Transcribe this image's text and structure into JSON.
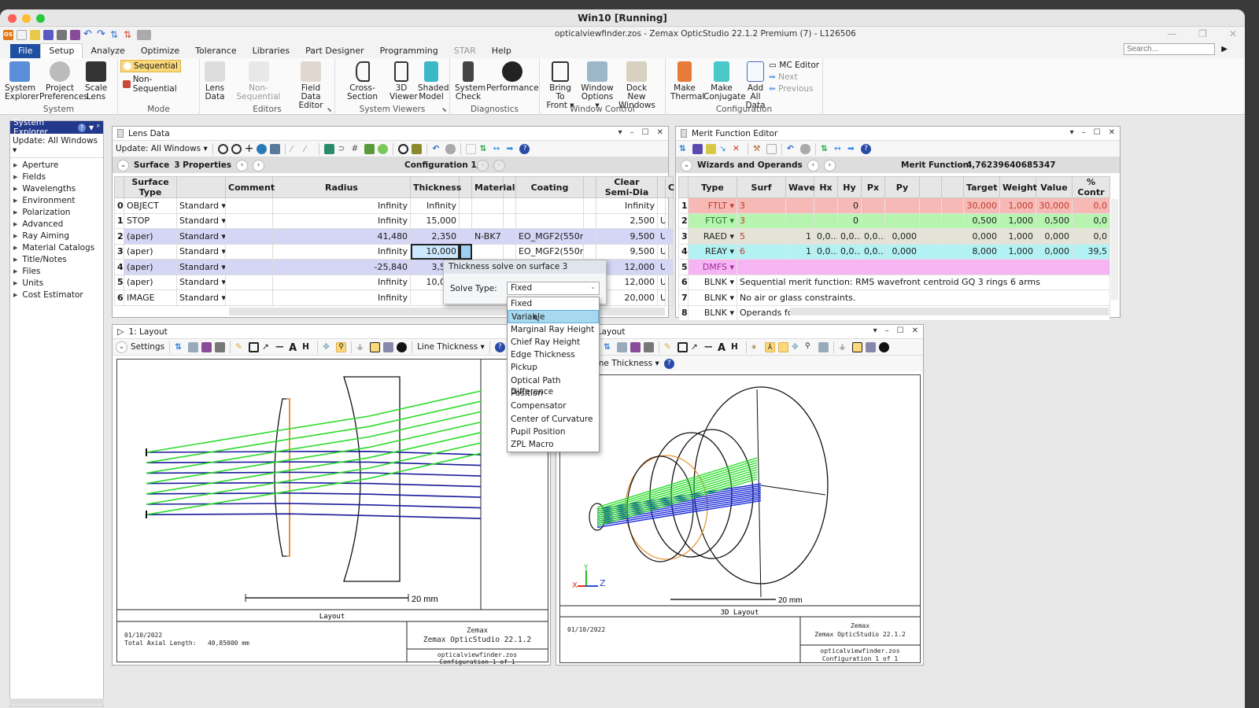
{
  "vm": {
    "title": "Win10 [Running]"
  },
  "app": {
    "title": "opticalviewfinder.zos - Zemax OpticStudio 22.1.2   Premium (7) - L126506",
    "logo": "OS"
  },
  "menu": {
    "tabs": [
      "File",
      "Setup",
      "Analyze",
      "Optimize",
      "Tolerance",
      "Libraries",
      "Part Designer",
      "Programming",
      "STAR",
      "Help"
    ],
    "active": "Setup",
    "search_placeholder": "Search..."
  },
  "ribbon": {
    "system": {
      "label": "System",
      "buttons": [
        "System Explorer",
        "Project Preferences",
        "Scale Lens"
      ]
    },
    "mode": {
      "label": "Mode",
      "sequential": "Sequential",
      "non_sequential": "Non-Sequential"
    },
    "editors": {
      "label": "Editors",
      "buttons": [
        "Lens Data",
        "Non-Sequential",
        "Field Data Editor"
      ]
    },
    "viewers": {
      "label": "System Viewers",
      "buttons": [
        "Cross-Section",
        "3D Viewer",
        "Shaded Model"
      ]
    },
    "diagnostics": {
      "label": "Diagnostics",
      "buttons": [
        "System Check",
        "Performance"
      ]
    },
    "window": {
      "label": "Window Control",
      "buttons": [
        "Bring To Front ▾",
        "Window Options ▾",
        "Dock New Windows"
      ]
    },
    "config": {
      "label": "Configuration",
      "buttons": [
        "Make Thermal",
        "Make Conjugate",
        "Add All Data"
      ],
      "small": [
        "MC Editor",
        "Next",
        "Previous"
      ]
    }
  },
  "explorer": {
    "title": "System Explorer",
    "update": "Update: All Windows ▾",
    "items": [
      "Aperture",
      "Fields",
      "Wavelengths",
      "Environment",
      "Polarization",
      "Advanced",
      "Ray Aiming",
      "Material Catalogs",
      "Title/Notes",
      "Files",
      "Units",
      "Cost Estimator"
    ]
  },
  "lens": {
    "title": "Lens Data",
    "update": "Update: All Windows ▾",
    "surface_label": "Surface",
    "properties": "3 Properties",
    "config": "Configuration 1/1",
    "columns": [
      "",
      "Surface Type",
      "",
      "Comment",
      "Radius",
      "Thickness",
      "",
      "Material",
      "",
      "Coating",
      "",
      "Clear Semi-Dia",
      "",
      "Cl"
    ],
    "rows": [
      {
        "n": "0",
        "name": "OBJECT",
        "type": "Standard ▾",
        "comment": "",
        "radius": "Infinity",
        "thick": "Infinity",
        "mat": "",
        "coat": "",
        "csd": "Infinity",
        "f": ""
      },
      {
        "n": "1",
        "name": "STOP",
        "type": "Standard ▾",
        "comment": "",
        "radius": "Infinity",
        "thick": "15,000",
        "mat": "",
        "coat": "",
        "csd": "2,500",
        "f": "U"
      },
      {
        "n": "2",
        "name": "(aper)",
        "type": "Standard ▾",
        "comment": "",
        "radius": "41,480",
        "thick": "2,350",
        "mat": "N-BK7",
        "coat": "EO_MGF2(550n...",
        "csd": "9,500",
        "f": "U"
      },
      {
        "n": "3",
        "name": "(aper)",
        "type": "Standard ▾",
        "comment": "",
        "radius": "Infinity",
        "thick": "10,000",
        "mat": "",
        "coat": "EO_MGF2(550n...",
        "csd": "9,500",
        "f": "U"
      },
      {
        "n": "4",
        "name": "(aper)",
        "type": "Standard ▾",
        "comment": "",
        "radius": "-25,840",
        "thick": "3,500",
        "mat": "",
        "coat": "",
        "csd": "12,000",
        "f": "U"
      },
      {
        "n": "5",
        "name": "(aper)",
        "type": "Standard ▾",
        "comment": "",
        "radius": "Infinity",
        "thick": "10,000",
        "mat": "",
        "coat": "",
        "csd": "12,000",
        "f": "U"
      },
      {
        "n": "6",
        "name": "IMAGE",
        "type": "Standard ▾",
        "comment": "",
        "radius": "Infinity",
        "thick": "-",
        "mat": "",
        "coat": "",
        "csd": "20,000",
        "f": "U"
      }
    ]
  },
  "solve": {
    "title": "Thickness solve on surface 3",
    "label": "Solve Type:",
    "value": "Fixed",
    "options": [
      "Fixed",
      "Variable",
      "Marginal Ray Height",
      "Chief Ray Height",
      "Edge Thickness",
      "Pickup",
      "Optical Path Difference",
      "Position",
      "Compensator",
      "Center of Curvature",
      "Pupil Position",
      "ZPL Macro"
    ],
    "hovered": "Variable"
  },
  "merit": {
    "title": "Merit Function Editor",
    "wizards": "Wizards and Operands",
    "mf_label": "Merit Function:",
    "mf_value": "4,76239640685347",
    "columns": [
      "",
      "Type",
      "Surf",
      "Wave",
      "Hx",
      "Hy",
      "Px",
      "Py",
      "",
      "",
      "Target",
      "Weight",
      "Value",
      "% Contr"
    ],
    "rows": [
      {
        "n": "1",
        "type": "FTLT ▾",
        "cells": [
          "3",
          "",
          "",
          "0",
          "",
          "",
          "",
          "",
          ""
        ],
        "target": "30,000",
        "weight": "1,000",
        "value": "30,000",
        "contr": "0,0",
        "color": "#f7b9b6"
      },
      {
        "n": "2",
        "type": "FTGT ▾",
        "cells": [
          "3",
          "",
          "",
          "0",
          "",
          "",
          "",
          "",
          ""
        ],
        "target": "0,500",
        "weight": "1,000",
        "value": "0,500",
        "contr": "0,0",
        "color": "#b6f4b0"
      },
      {
        "n": "3",
        "type": "RAED ▾",
        "cells": [
          "5",
          "1",
          "0,0...",
          "0,0...",
          "0,0...",
          "0,000",
          "",
          ""
        ],
        "target": "0,000",
        "weight": "1,000",
        "value": "0,000",
        "contr": "0,0",
        "color": "#e3e3d8"
      },
      {
        "n": "4",
        "type": "REAY ▾",
        "cells": [
          "6",
          "1",
          "0,0...",
          "0,0...",
          "0,0...",
          "0,000",
          "",
          ""
        ],
        "target": "8,000",
        "weight": "1,000",
        "value": "0,000",
        "contr": "39,5",
        "color": "#b2f2f4"
      },
      {
        "n": "5",
        "type": "DMFS ▾",
        "comment": "",
        "color": "#f6b5f2"
      },
      {
        "n": "6",
        "type": "BLNK ▾",
        "comment": "Sequential merit function: RMS wavefront centroid GQ 3 rings 6 arms",
        "color": "#ffffff"
      },
      {
        "n": "7",
        "type": "BLNK ▾",
        "comment": "No air or glass constraints.",
        "color": "#ffffff"
      },
      {
        "n": "8",
        "type": "BLNK ▾",
        "comment": "Operands for field 1.",
        "color": "#ffffff"
      }
    ]
  },
  "layout": {
    "title": "1: Layout",
    "settings": "Settings",
    "line_thickness": "Line Thickness ▾",
    "scale": "20 mm",
    "caption": "Layout",
    "date": "01/10/2022",
    "axial": "Total Axial Length:   40,85000 mm",
    "company": "Zemax",
    "product": "Zemax OpticStudio 22.1.2",
    "file": "opticalviewfinder.zos",
    "config": "Configuration 1 of 1"
  },
  "layout3d": {
    "title": "2: 3D Layout",
    "line_thickness": "Line Thickness ▾",
    "scale": "20 mm",
    "caption": "3D Layout",
    "date": "01/10/2022",
    "company": "Zemax",
    "product": "Zemax OpticStudio 22.1.2",
    "file": "opticalviewfinder.zos",
    "config": "Configuration 1 of 1",
    "axes": {
      "x": "X",
      "y": "Y",
      "z": "Z"
    }
  }
}
